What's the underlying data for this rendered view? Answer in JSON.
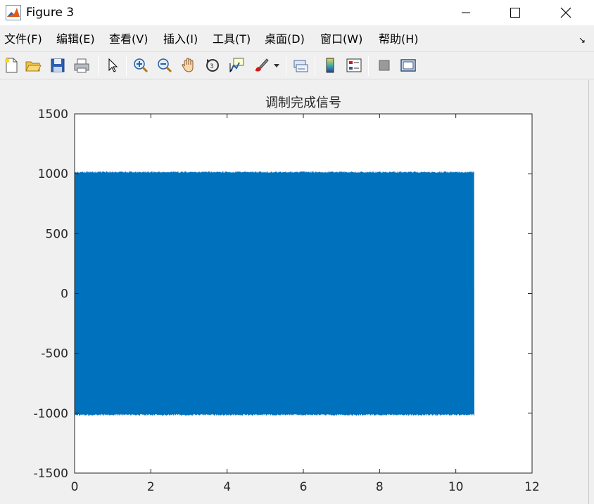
{
  "window": {
    "title": "Figure 3",
    "controls": [
      "minimize",
      "maximize",
      "close"
    ]
  },
  "menubar": {
    "items": [
      {
        "label": "文件(F)"
      },
      {
        "label": "编辑(E)"
      },
      {
        "label": "查看(V)"
      },
      {
        "label": "插入(I)"
      },
      {
        "label": "工具(T)"
      },
      {
        "label": "桌面(D)"
      },
      {
        "label": "窗口(W)"
      },
      {
        "label": "帮助(H)"
      }
    ],
    "dock_arrow": "↘"
  },
  "toolbar": {
    "icons": [
      "new-figure-icon",
      "open-file-icon",
      "save-icon",
      "print-icon",
      "pointer-arrow-icon",
      "zoom-in-icon",
      "zoom-out-icon",
      "pan-hand-icon",
      "rotate-3d-icon",
      "data-cursor-icon",
      "brush-icon",
      "link-plot-icon",
      "colorbar-icon",
      "legend-icon",
      "hide-plot-tools-icon",
      "show-plot-tools-icon"
    ]
  },
  "chart_data": {
    "type": "line",
    "title": "调制完成信号",
    "xlabel": "",
    "ylabel": "",
    "xlim": [
      0,
      12
    ],
    "ylim": [
      -1500,
      1500
    ],
    "xticks": [
      0,
      2,
      4,
      6,
      8,
      10,
      12
    ],
    "yticks": [
      1500,
      1000,
      500,
      0,
      -500,
      -1000,
      -1500
    ],
    "series": [
      {
        "x_range": [
          0,
          10.48
        ],
        "amplitude_range": [
          -1020,
          1020
        ],
        "color": "#0072bd",
        "description_shape": "dense oscillation"
      }
    ],
    "grid": false,
    "box": true
  }
}
